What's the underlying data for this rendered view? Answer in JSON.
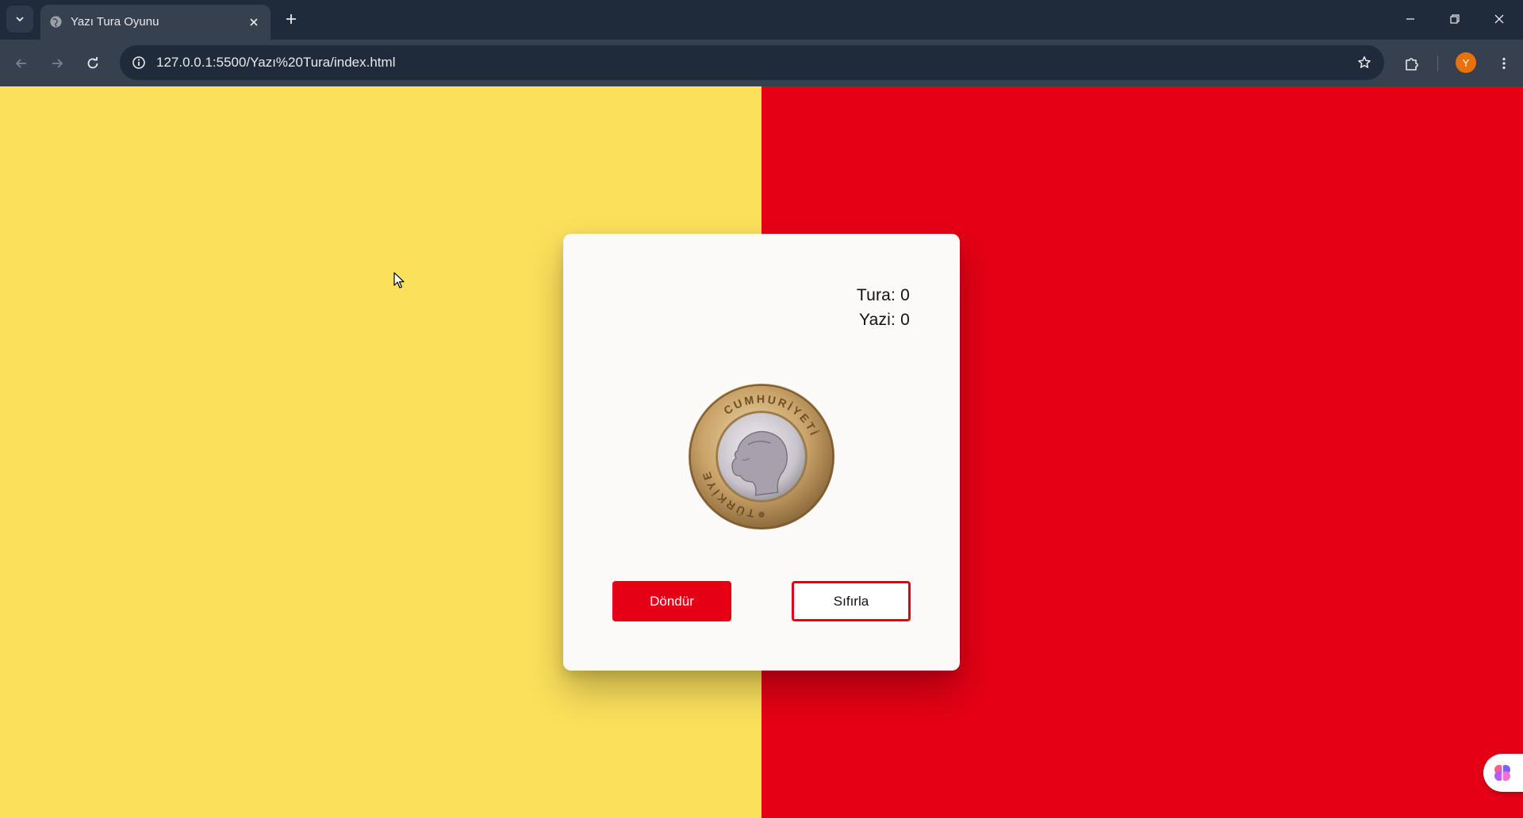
{
  "browser": {
    "tab": {
      "title": "Yazı Tura Oyunu"
    },
    "url": "127.0.0.1:5500/Yazı%20Tura/index.html",
    "profile_initial": "Y",
    "icons": {
      "tab_search": "chevron-down-icon",
      "favicon": "globe-icon",
      "tab_close": "close-icon",
      "new_tab": "plus-icon",
      "minimize": "minimize-icon",
      "restore": "restore-icon",
      "close_window": "close-icon",
      "back": "arrow-left-icon",
      "forward": "arrow-right-icon",
      "reload": "reload-icon",
      "site_info": "info-icon",
      "bookmark": "star-icon",
      "extensions": "puzzle-icon",
      "menu": "more-vert-icon"
    }
  },
  "page": {
    "colors": {
      "left_bg": "#fbe05c",
      "right_bg": "#e50016",
      "accent": "#e50016"
    },
    "score": {
      "tura": "Tura: 0",
      "yazi": "Yazi: 0"
    },
    "coin": {
      "top_text": "CUMHURİYETİ",
      "bottom_text": "TÜRKİYE"
    },
    "buttons": {
      "spin": "Döndür",
      "reset": "Sıfırla"
    },
    "floating_widget_icon": "brain-icon"
  }
}
